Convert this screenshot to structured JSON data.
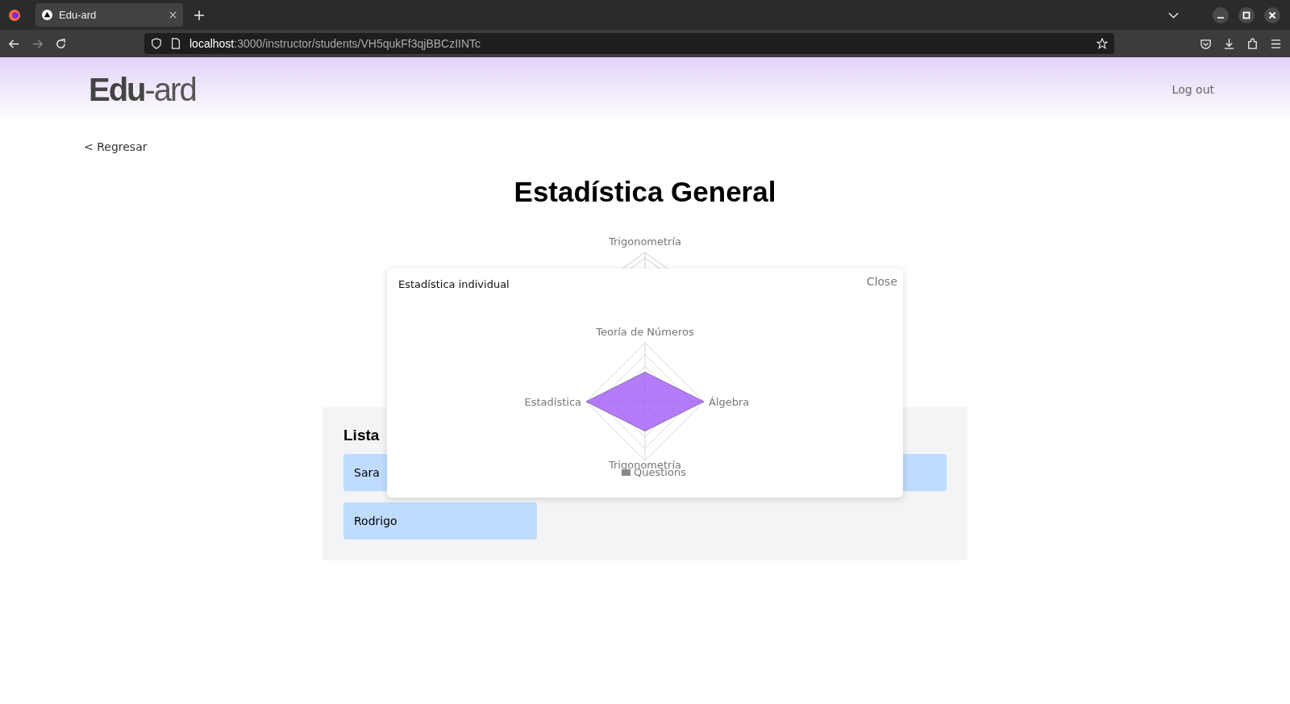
{
  "browser": {
    "tab_title": "Edu-ard",
    "url_host": "localhost",
    "url_path": ":3000/instructor/students/VH5qukFf3qjBBCzIINTc"
  },
  "header": {
    "logo_bold": "Edu",
    "logo_light": "-ard",
    "logout": "Log out"
  },
  "back_link": "< Regresar",
  "title": "Estadística General",
  "background_chart": {
    "axis_label": "Trigonometría"
  },
  "list": {
    "heading": "Lista",
    "students": [
      "Sara",
      "Rodrigo"
    ]
  },
  "modal": {
    "title": "Estadística individual",
    "close": "Close",
    "chart": {
      "axes": [
        "Teoría de Números",
        "Álgebra",
        "Trigonometría",
        "Estadística"
      ],
      "legend": "Questions"
    }
  }
}
